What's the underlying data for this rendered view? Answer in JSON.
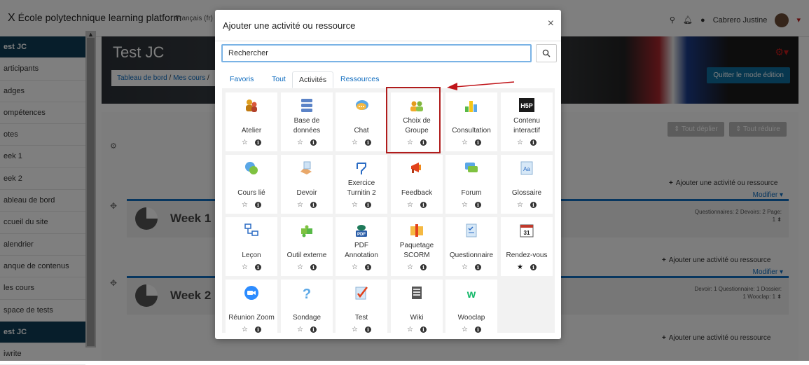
{
  "topbar": {
    "brand": "École polytechnique learning platform",
    "lang": "Français (fr)",
    "user": "Cabrero Justine"
  },
  "sidebar": {
    "items": [
      {
        "label": "est JC",
        "dark": true
      },
      {
        "label": "articipants"
      },
      {
        "label": "adges"
      },
      {
        "label": "ompétences"
      },
      {
        "label": "otes"
      },
      {
        "label": "eek 1"
      },
      {
        "label": "eek 2"
      },
      {
        "label": "ableau de bord"
      },
      {
        "label": "ccueil du site"
      },
      {
        "label": "alendrier"
      },
      {
        "label": "anque de contenus"
      },
      {
        "label": "les cours"
      },
      {
        "label": "space de tests"
      },
      {
        "label": "est JC",
        "dark": true
      },
      {
        "label": "iwrite"
      }
    ]
  },
  "course": {
    "title": "Test JC",
    "breadcrumb_home": "Tableau de bord",
    "breadcrumb_sep": "/",
    "breadcrumb_courses": "Mes cours",
    "quit_edit": "Quitter le mode édition"
  },
  "main": {
    "expand_all": "Tout déplier",
    "collapse_all": "Tout réduire",
    "add_activity": "Ajouter une activité ou ressource",
    "modify": "Modifier",
    "weeks": [
      {
        "title": "Week 1",
        "summary_line1": "Questionnaires: 2 Devoirs: 2 Page:",
        "summary_line2": "1"
      },
      {
        "title": "Week 2",
        "summary_line1": "Devoir: 1 Questionnaire: 1 Dossier:",
        "summary_line2": "1 Wooclap: 1"
      }
    ]
  },
  "modal": {
    "title": "Ajouter une activité ou ressource",
    "close": "×",
    "search_placeholder": "Rechercher",
    "tabs": [
      "Favoris",
      "Tout",
      "Activités",
      "Ressources"
    ],
    "active_tab": "Activités",
    "tiles": [
      {
        "label": "Atelier",
        "icon": "atelier-icon",
        "fav": false
      },
      {
        "label": "Base de données",
        "icon": "database-icon",
        "fav": false
      },
      {
        "label": "Chat",
        "icon": "chat-icon",
        "fav": false
      },
      {
        "label": "Choix de Groupe",
        "icon": "group-choice-icon",
        "fav": false
      },
      {
        "label": "Consultation",
        "icon": "chart-icon",
        "fav": false
      },
      {
        "label": "Contenu interactif",
        "icon": "h5p-icon",
        "fav": false
      },
      {
        "label": "Cours lié",
        "icon": "linked-course-icon",
        "fav": false
      },
      {
        "label": "Devoir",
        "icon": "assignment-icon",
        "fav": false
      },
      {
        "label": "Exercice Turnitin 2",
        "icon": "turnitin-icon",
        "fav": false
      },
      {
        "label": "Feedback",
        "icon": "megaphone-icon",
        "fav": false
      },
      {
        "label": "Forum",
        "icon": "forum-icon",
        "fav": false
      },
      {
        "label": "Glossaire",
        "icon": "glossary-icon",
        "fav": false
      },
      {
        "label": "Leçon",
        "icon": "lesson-icon",
        "fav": false
      },
      {
        "label": "Outil externe",
        "icon": "puzzle-icon",
        "fav": false
      },
      {
        "label": "PDF Annotation",
        "icon": "pdf-icon",
        "fav": false
      },
      {
        "label": "Paquetage SCORM",
        "icon": "scorm-icon",
        "fav": false
      },
      {
        "label": "Questionnaire",
        "icon": "questionnaire-icon",
        "fav": false
      },
      {
        "label": "Rendez-vous",
        "icon": "calendar-icon",
        "fav": true
      },
      {
        "label": "Réunion Zoom",
        "icon": "zoom-icon",
        "fav": false
      },
      {
        "label": "Sondage",
        "icon": "question-mark-icon",
        "fav": false
      },
      {
        "label": "Test",
        "icon": "quiz-icon",
        "fav": false
      },
      {
        "label": "Wiki",
        "icon": "wiki-icon",
        "fav": false
      },
      {
        "label": "Wooclap",
        "icon": "wooclap-icon",
        "fav": false
      }
    ]
  },
  "colors": {
    "brand_blue": "#0f6cbf",
    "dark_nav": "#0f3d57",
    "highlight_red": "#b01c1c"
  }
}
